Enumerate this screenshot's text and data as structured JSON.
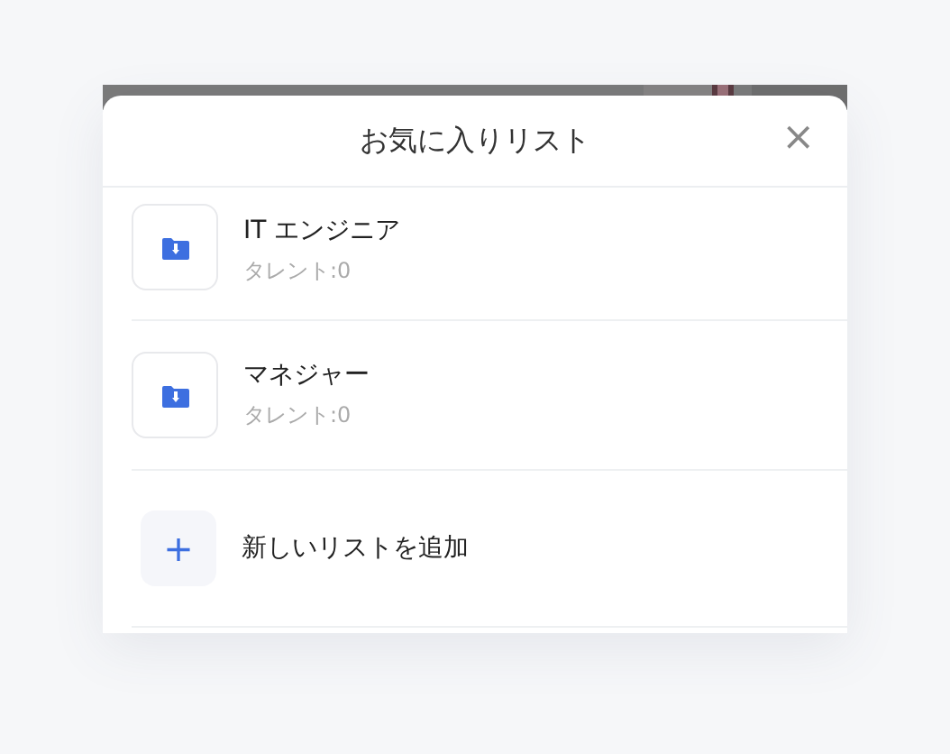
{
  "dialog": {
    "title": "お気に入りリスト",
    "close": "×"
  },
  "lists": [
    {
      "name": "IT エンジニア",
      "count": "タレント:0"
    },
    {
      "name": "マネジャー",
      "count": "タレント:0"
    }
  ],
  "add_button": {
    "icon": "+",
    "label": "新しいリストを追加"
  }
}
